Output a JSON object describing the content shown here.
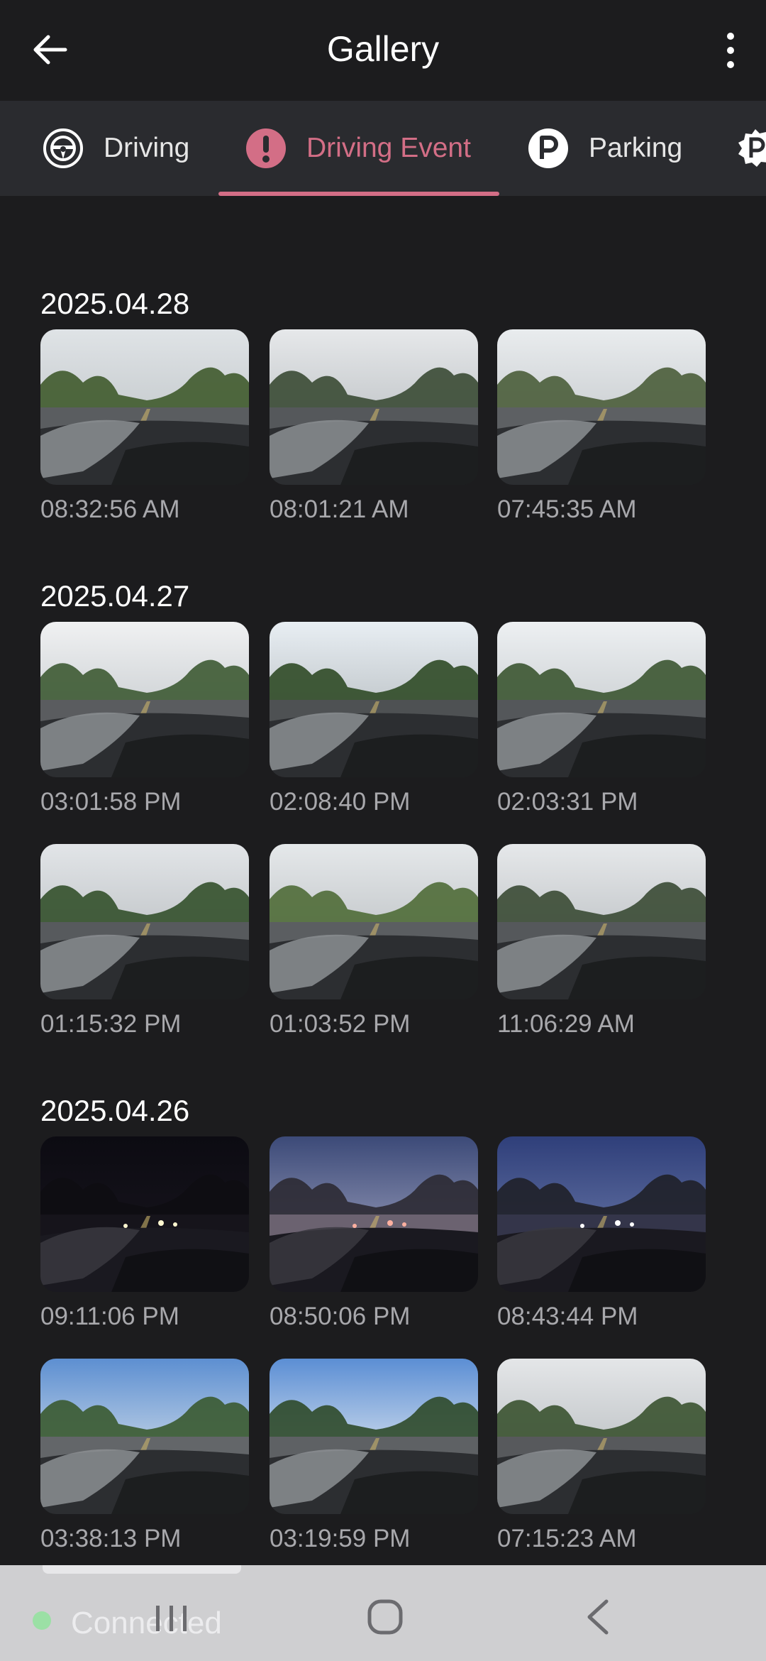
{
  "header": {
    "title": "Gallery",
    "back_icon": "back-arrow-icon",
    "more_icon": "more-vertical-icon"
  },
  "tabs": [
    {
      "label": "Driving",
      "icon": "steering-wheel-icon",
      "active": false
    },
    {
      "label": "Driving Event",
      "icon": "alert-icon",
      "active": true
    },
    {
      "label": "Parking",
      "icon": "parking-icon",
      "active": false
    },
    {
      "label": "",
      "icon": "parking-event-icon",
      "active": false
    }
  ],
  "accent_color": "#d36e86",
  "groups": [
    {
      "date": "2025.04.28",
      "items": [
        {
          "time": "08:32:56 AM",
          "scene": "day-trees"
        },
        {
          "time": "08:01:21 AM",
          "scene": "day-open"
        },
        {
          "time": "07:45:35 AM",
          "scene": "day-house"
        }
      ]
    },
    {
      "date": "2025.04.27",
      "items": [
        {
          "time": "03:01:58 PM",
          "scene": "day-highway"
        },
        {
          "time": "02:08:40 PM",
          "scene": "day-forest"
        },
        {
          "time": "02:03:31 PM",
          "scene": "day-bridge"
        },
        {
          "time": "01:15:32 PM",
          "scene": "day-cars"
        },
        {
          "time": "01:03:52 PM",
          "scene": "day-sign"
        },
        {
          "time": "11:06:29 AM",
          "scene": "day-open"
        }
      ]
    },
    {
      "date": "2025.04.26",
      "items": [
        {
          "time": "09:11:06 PM",
          "scene": "night-dark"
        },
        {
          "time": "08:50:06 PM",
          "scene": "dusk-lot"
        },
        {
          "time": "08:43:44 PM",
          "scene": "dusk-house"
        },
        {
          "time": "03:38:13 PM",
          "scene": "blue-lights"
        },
        {
          "time": "03:19:59 PM",
          "scene": "blue-open"
        },
        {
          "time": "07:15:23 AM",
          "scene": "day-lights"
        }
      ]
    }
  ],
  "status": {
    "label": "Connected",
    "color": "#9be0a5"
  },
  "system_nav": {
    "recent_icon": "recent-apps-icon",
    "home_icon": "home-icon",
    "back_icon": "nav-back-icon"
  }
}
